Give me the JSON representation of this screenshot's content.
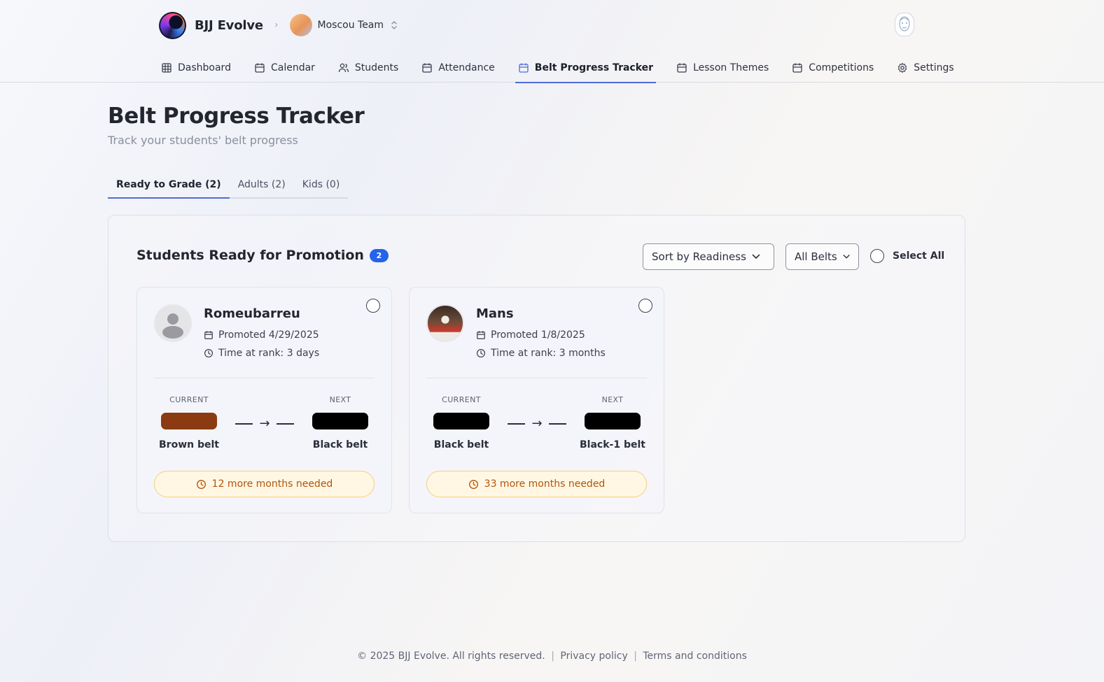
{
  "app": {
    "brand_name": "BJJ Evolve",
    "breadcrumb_separator": ">",
    "team_name": "Moscou Team"
  },
  "nav": {
    "items": [
      {
        "label": "Dashboard",
        "icon": "grid-icon",
        "active": false
      },
      {
        "label": "Calendar",
        "icon": "calendar-icon",
        "active": false
      },
      {
        "label": "Students",
        "icon": "users-icon",
        "active": false
      },
      {
        "label": "Attendance",
        "icon": "calendar-icon",
        "active": false
      },
      {
        "label": "Belt Progress Tracker",
        "icon": "calendar-icon",
        "active": true
      },
      {
        "label": "Lesson Themes",
        "icon": "calendar-icon",
        "active": false
      },
      {
        "label": "Competitions",
        "icon": "calendar-icon",
        "active": false
      },
      {
        "label": "Settings",
        "icon": "gear-icon",
        "active": false
      }
    ]
  },
  "page": {
    "title": "Belt Progress Tracker",
    "subtitle": "Track your students' belt progress"
  },
  "tabs": [
    {
      "label": "Ready to Grade (2)",
      "active": true
    },
    {
      "label": "Adults (2)",
      "active": false
    },
    {
      "label": "Kids (0)",
      "active": false
    }
  ],
  "panel": {
    "title": "Students Ready for Promotion",
    "count": "2",
    "sort_select": "Sort by Readiness",
    "belt_select": "All Belts",
    "select_all_label": "Select All"
  },
  "students": [
    {
      "name": "Romeubarreu",
      "promoted": "Promoted 4/29/2025",
      "time_at_rank": "Time at rank: 3 days",
      "current_label": "CURRENT",
      "next_label": "NEXT",
      "current_belt": "Brown belt",
      "current_color": "#8b3a12",
      "next_belt": "Black belt",
      "next_color": "#000000",
      "needed": "12 more months needed",
      "avatar": "placeholder"
    },
    {
      "name": "Mans",
      "promoted": "Promoted 1/8/2025",
      "time_at_rank": "Time at rank: 3 months",
      "current_label": "CURRENT",
      "next_label": "NEXT",
      "current_belt": "Black belt",
      "current_color": "#000000",
      "next_belt": "Black-1 belt",
      "next_color": "#000000",
      "needed": "33 more months needed",
      "avatar": "photo"
    }
  ],
  "footer": {
    "copyright": "© 2025 BJJ Evolve. All rights reserved.",
    "privacy": "Privacy policy",
    "terms": "Terms and conditions"
  },
  "colors": {
    "accent": "#4f6bd8",
    "badge": "#2563eb",
    "warning_text": "#b45309",
    "warning_bg": "#fff7e3"
  }
}
